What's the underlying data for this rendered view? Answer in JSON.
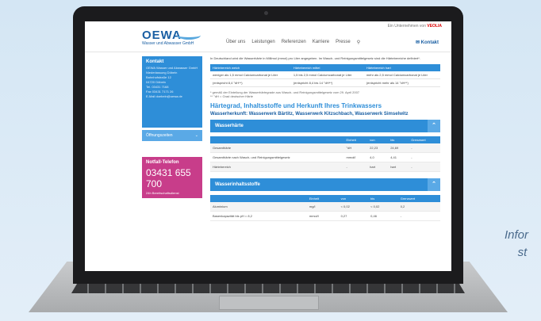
{
  "side_text": "Infor\n    st",
  "header": {
    "logo": "OEWA",
    "logo_sub": "Wasser und Abwasser GmbH",
    "partner_text": "Ein Unternehmen von",
    "partner_brand": "VEOLIA",
    "nav": [
      "Über uns",
      "Leistungen",
      "Referenzen",
      "Karriere",
      "Presse"
    ],
    "kontakt": "Kontakt"
  },
  "sidebar": {
    "contact_title": "Kontakt",
    "contact_lines": [
      "OEWA Wasser und Abwasser GmbH",
      "Niederlassung Döbeln",
      "Bahnhofstraße 12",
      "04720 Döbeln",
      "Tel.   03431 7168",
      "Fax    03431 7171 26",
      "E-Mail  doebeln@oewa.de"
    ],
    "hours": "Öffnungszeiten",
    "notruf_title": "Notfall-Telefon",
    "notruf_number": "03431 655 700",
    "notruf_sub": "24h Bereitschaftsdienst"
  },
  "content": {
    "intro": "In Deutschland wird die Wasserhärte in Millimol (mmol) pro Liter angegeben. Im Wasch- und Reinigungsmittelgesetz sind die Härtebereiche definiert*.",
    "hardness_table": {
      "headers": [
        "Härtebereich weich",
        "Härtebereich mittel",
        "Härtebereich hart"
      ],
      "rows": [
        [
          "weniger als 1,5 mmol Calciumcarbonat je Liter",
          "1,5 bis 2,5 mmol Calciumcarbonat je Liter",
          "mehr als 2,5 mmol Calciumcarbonat je Liter"
        ],
        [
          "(entspricht 8,4 °dH**)",
          "(entspricht 8,4 bis 14 °dH**)",
          "(entspricht mehr als 14 °dH**)"
        ]
      ]
    },
    "footnote1": "* gemäß der Einteilung der Wasserhärtegrade aus Wasch- und Reinigungsmittelgesetz vom 29. April 2007",
    "footnote2": "** °dH = Grad deutscher Härte",
    "heading": "Härtegrad, Inhaltsstoffe und Herkunft Ihres Trinkwassers",
    "subheading": "Wasserherkunft: Wasserwerk Bärtitz, Wasserwerk Kitzschbach, Wasserwerk Simselwitz",
    "section1": {
      "title": "Wasserhärte",
      "headers": [
        "",
        "Einheit",
        "von",
        "bis",
        "Grenzwert"
      ],
      "rows": [
        [
          "Gesamthärte",
          "°dH",
          "22,23",
          "24,69",
          "-"
        ],
        [
          "Gesamthärte nach Wasch- und Reinigungsmittelgesetz",
          "mmol/l",
          "4,0",
          "4,41",
          "-"
        ],
        [
          "Härtebereich",
          "-",
          "hart",
          "hart",
          "-"
        ]
      ]
    },
    "section2": {
      "title": "Wasserinhaltsstoffe",
      "headers": [
        "",
        "Einheit",
        "von",
        "bis",
        "Grenzwert"
      ],
      "rows": [
        [
          "Aluminium",
          "mg/l",
          "< 0,02",
          "< 0,02",
          "0,2"
        ],
        [
          "Basenkapazität bis pH = 8,2",
          "mmol/l",
          "0,27",
          "0,46",
          "-"
        ]
      ]
    }
  }
}
